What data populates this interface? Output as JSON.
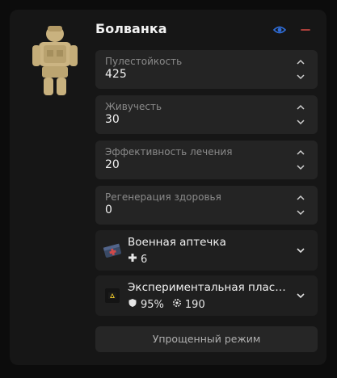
{
  "header": {
    "title": "Болванка"
  },
  "colors": {
    "eye": "#2f6cd6",
    "minus": "#c0453f",
    "card": "#242424",
    "panel": "#161616"
  },
  "stats": [
    {
      "label": "Пулестойкость",
      "value": "425"
    },
    {
      "label": "Живучесть",
      "value": "30"
    },
    {
      "label": "Эффективность лечения",
      "value": "20"
    },
    {
      "label": "Регенерация здоровья",
      "value": "0"
    }
  ],
  "items": [
    {
      "name": "Военная аптечка",
      "icon": "medkit-icon",
      "meta1_icon": "plus-icon",
      "meta1": "6"
    },
    {
      "name": "Экспериментальная пласт...",
      "icon": "armor-plate-icon",
      "meta1_icon": "shield-icon",
      "meta1": "95%",
      "meta2_icon": "gear-icon",
      "meta2": "190"
    }
  ],
  "footer": {
    "simple_mode_label": "Упрощенный режим"
  }
}
